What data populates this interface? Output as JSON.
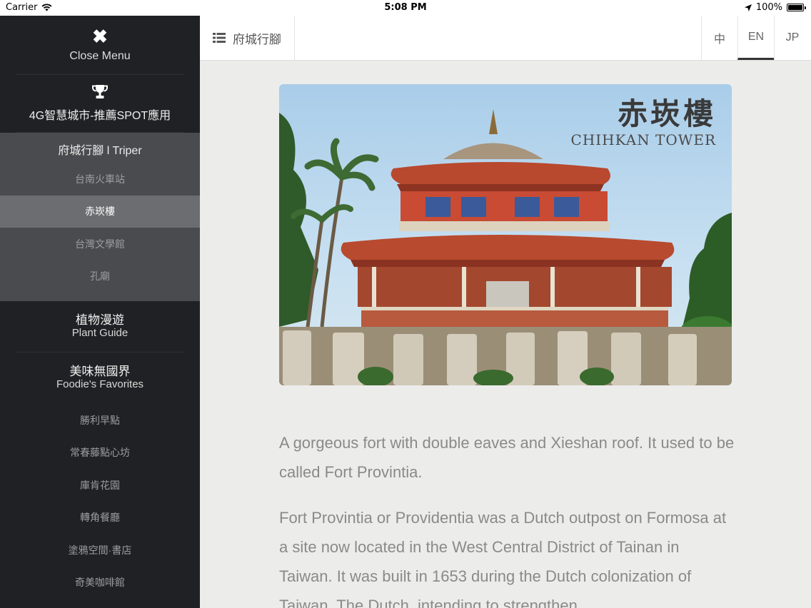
{
  "status_bar": {
    "carrier": "Carrier",
    "time": "5:08 PM",
    "battery": "100%",
    "battery_level": 1.0
  },
  "sidebar": {
    "close_label": "Close Menu",
    "spot_label": "4G智慧城市-推薦SPOT應用",
    "triper": {
      "title": "府城行腳 l Triper",
      "items": [
        "台南火車站",
        "赤崁樓",
        "台灣文學館",
        "孔廟"
      ],
      "active_index": 1
    },
    "plant": {
      "zh": "植物漫遊",
      "en": "Plant Guide"
    },
    "foodie": {
      "zh": "美味無國界",
      "en": "Foodie's Favorites",
      "items": [
        "勝利早點",
        "常春藤點心坊",
        "庫肯花園",
        "轉角餐廳",
        "塗鴉空間·書店",
        "奇美咖啡館"
      ]
    }
  },
  "topbar": {
    "menu_label": "府城行腳",
    "languages": [
      "中",
      "EN",
      "JP"
    ],
    "active_language": "EN"
  },
  "hero": {
    "title_zh": "赤崁樓",
    "title_en": "CHIHKAN TOWER"
  },
  "article": {
    "paragraphs": [
      "A gorgeous fort with double eaves and Xieshan roof. It used to be called Fort Provintia.",
      "Fort Provintia or Providentia was a Dutch outpost on Formosa at a site now located in the West Central District of Tainan in Taiwan. It was built in 1653 during the Dutch colonization of Taiwan. The Dutch, intending to strengthen"
    ]
  },
  "colors": {
    "sidebar_bg": "#202124",
    "triper_bg": "#4a4b4e",
    "active_item_bg": "#6c6d70",
    "content_bg": "#ececeb"
  }
}
